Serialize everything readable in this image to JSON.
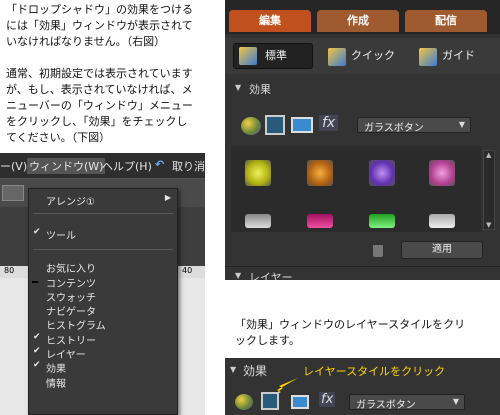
{
  "intro": {
    "line1": "「ドロップシャドウ」の効果をつける",
    "line2": "には「効果」ウィンドウが表示されて",
    "line3": "いなければなりません。（右図）",
    "line4": "通常、初期設定では表示されています",
    "line5": "が、もし、表示されていなければ、メ",
    "line6": "ニューバーの「ウィンドウ」メニュー",
    "line7": "をクリックし、「効果」をチェックし",
    "line8": "てください。（下図）"
  },
  "menubar": {
    "item_view": "ー(V)",
    "item_window": "ウィンドウ(W)",
    "item_help": "ヘルプ(H)",
    "item_undo": "取り消"
  },
  "ruler": {
    "left_number": "80",
    "right_number": "40"
  },
  "window_menu": {
    "items": [
      {
        "label": "アレンジ①",
        "checked": false,
        "submenu": true
      },
      {
        "label": "ツール",
        "checked": true
      },
      {
        "label": "お気に入り",
        "checked": false
      },
      {
        "label": "コンテンツ",
        "checked": false
      },
      {
        "label": "スウォッチ",
        "checked": false
      },
      {
        "label": "ナビゲータ",
        "checked": false
      },
      {
        "label": "ヒストグラム",
        "checked": false
      },
      {
        "label": "ヒストリー",
        "checked": true
      },
      {
        "label": "レイヤー",
        "checked": true
      },
      {
        "label": "効果",
        "checked": true
      },
      {
        "label": "情報",
        "checked": false
      }
    ]
  },
  "panel": {
    "tabs": [
      "編集",
      "作成",
      "配信"
    ],
    "modes": [
      "標準",
      "クイック",
      "ガイド"
    ],
    "section_title": "効果",
    "dropdown_value": "ガラスボタン",
    "apply_button": "適用",
    "layer_section": "レイヤー"
  },
  "caption": {
    "line1": "「効果」ウィンドウのレイヤースタイルをクリ",
    "line2": "ックします。"
  },
  "strip": {
    "section_title": "効果",
    "callout": "レイヤースタイルをクリック",
    "dropdown_value": "ガラスボタン"
  },
  "colors": {
    "tab_active": "#c0501e",
    "tab_inactive": "#a05a30",
    "callout_text": "#ffd700"
  }
}
